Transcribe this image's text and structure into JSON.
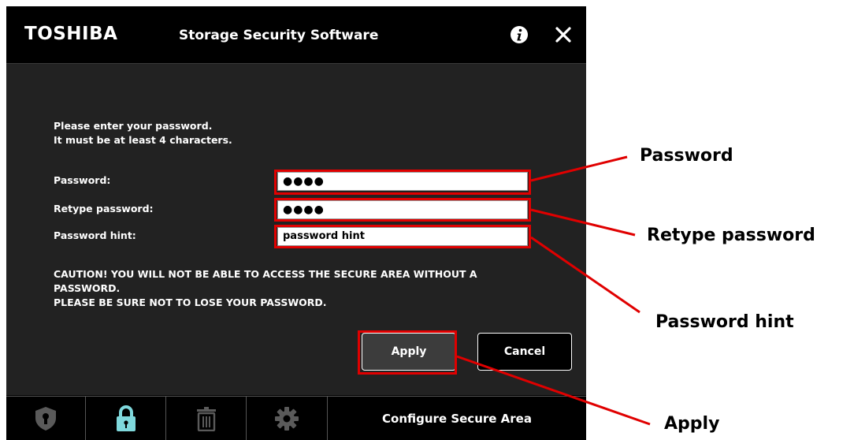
{
  "window": {
    "brand": "TOSHIBA",
    "title": "Storage Security Software"
  },
  "form": {
    "instructions_line1": "Please enter your password.",
    "instructions_line2": "It must be at least 4 characters.",
    "password_label": "Password:",
    "password_value": "●●●●",
    "retype_label": "Retype password:",
    "retype_value": "●●●●",
    "hint_label": "Password hint:",
    "hint_value": "password hint",
    "caution_line1": "CAUTION!  YOU WILL NOT BE ABLE TO ACCESS THE SECURE AREA WITHOUT A",
    "caution_line2": "PASSWORD.",
    "caution_line3": "PLEASE BE SURE NOT TO LOSE YOUR PASSWORD.",
    "apply_label": "Apply",
    "cancel_label": "Cancel"
  },
  "toolbar": {
    "items": [
      {
        "icon": "shield-icon",
        "active": false
      },
      {
        "icon": "lock-icon",
        "active": true
      },
      {
        "icon": "trash-icon",
        "active": false
      },
      {
        "icon": "gear-icon",
        "active": false
      }
    ],
    "configure_label": "Configure Secure Area"
  },
  "callouts": {
    "password": "Password",
    "retype_password": "Retype password",
    "password_hint": "Password hint",
    "apply": "Apply"
  },
  "colors": {
    "highlight": "#e00000",
    "active_icon": "#7fd8dc",
    "inactive_icon": "#5a5a5a"
  }
}
